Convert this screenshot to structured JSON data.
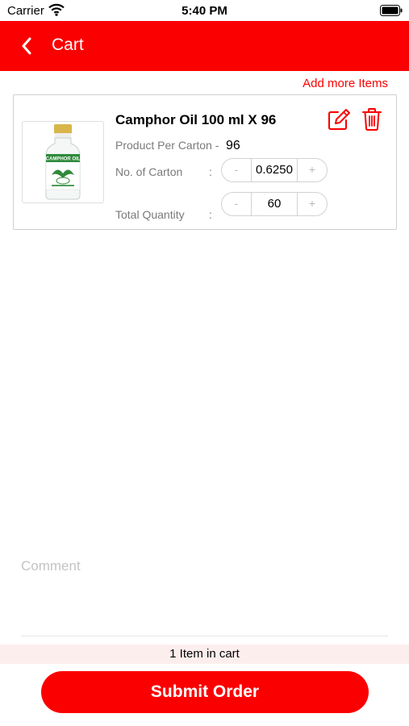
{
  "status_bar": {
    "carrier": "Carrier",
    "time": "5:40 PM"
  },
  "nav": {
    "title": "Cart",
    "back_icon": "chevron-left-icon"
  },
  "add_more_label": "Add more Items",
  "item": {
    "name": "Camphor Oil 100 ml X 96",
    "per_carton_label": "Product Per Carton -",
    "per_carton_value": "96",
    "carton_label": "No. of Carton",
    "carton_colon": ":",
    "carton_value": "0.6250",
    "quantity_label": "Total Quantity",
    "quantity_colon": ":",
    "quantity_value": "60",
    "minus": "-",
    "plus": "+",
    "bottle_label": "CAMPHOR OIL"
  },
  "comment_placeholder": "Comment",
  "cart_count_text": "1 Item in cart",
  "submit_label": "Submit Order",
  "colors": {
    "accent": "#fb0000",
    "footer_tint": "#fdeeee"
  }
}
